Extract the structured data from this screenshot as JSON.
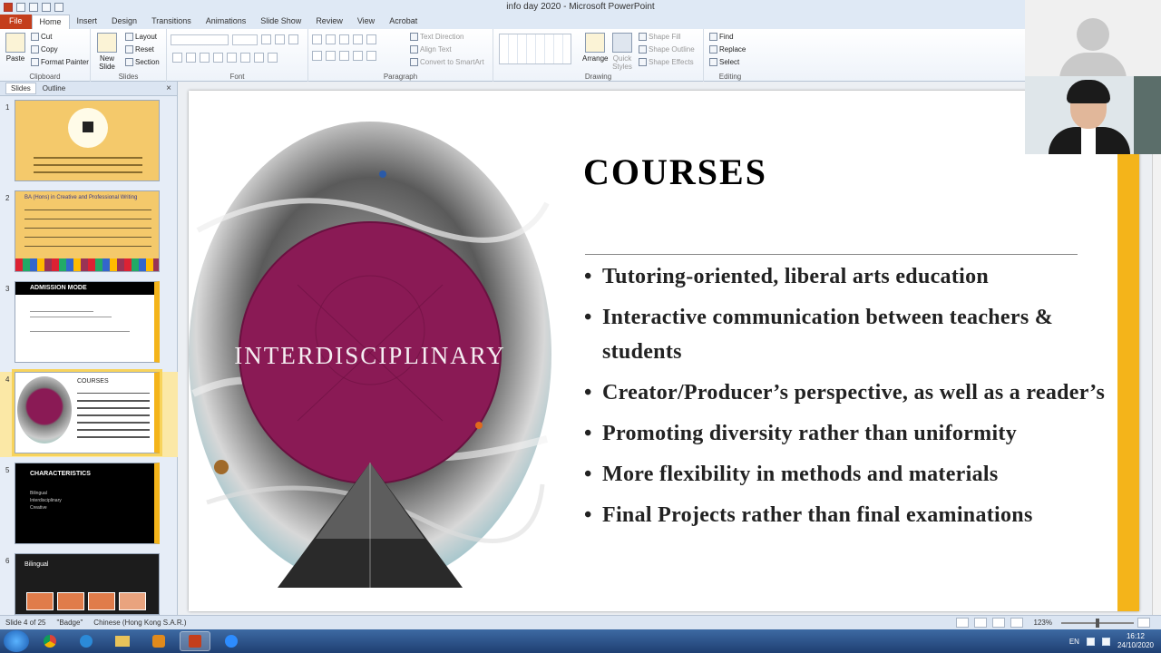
{
  "window": {
    "title": "info day 2020  -  Microsoft PowerPoint"
  },
  "tabs": [
    {
      "label": "File"
    },
    {
      "label": "Home"
    },
    {
      "label": "Insert"
    },
    {
      "label": "Design"
    },
    {
      "label": "Transitions"
    },
    {
      "label": "Animations"
    },
    {
      "label": "Slide Show"
    },
    {
      "label": "Review"
    },
    {
      "label": "View"
    },
    {
      "label": "Acrobat"
    }
  ],
  "ribbon": {
    "clipboard": {
      "paste": "Paste",
      "cut": "Cut",
      "copy": "Copy",
      "format_painter": "Format Painter",
      "label": "Clipboard"
    },
    "slides": {
      "new_slide": "New Slide",
      "layout": "Layout",
      "reset": "Reset",
      "section": "Section",
      "label": "Slides"
    },
    "font": {
      "label": "Font"
    },
    "paragraph": {
      "text_direction": "Text Direction",
      "align_text": "Align Text",
      "convert_smartart": "Convert to SmartArt",
      "label": "Paragraph"
    },
    "drawing": {
      "arrange": "Arrange",
      "quick_styles": "Quick Styles",
      "shape_fill": "Shape Fill",
      "shape_outline": "Shape Outline",
      "shape_effects": "Shape Effects",
      "label": "Drawing"
    },
    "editing": {
      "find": "Find",
      "replace": "Replace",
      "select": "Select",
      "label": "Editing"
    }
  },
  "panel": {
    "tab_slides": "Slides",
    "tab_outline": "Outline",
    "close": "×",
    "thumbnails": [
      {
        "num": "1"
      },
      {
        "num": "2",
        "heading": "BA (Hons) in Creative and Professional Writing"
      },
      {
        "num": "3",
        "heading": "ADMISSION MODE"
      },
      {
        "num": "4",
        "heading": "COURSES"
      },
      {
        "num": "5",
        "heading": "CHARACTERISTICS",
        "items": [
          "Bilingual",
          "Interdisciplinary",
          "Creative"
        ]
      },
      {
        "num": "6",
        "heading": "Bilingual"
      }
    ]
  },
  "slide": {
    "art_text": "INTERDISCIPLINARY",
    "title": "COURSES",
    "bullets": [
      "Tutoring-oriented, liberal arts education",
      "Interactive communication between teachers & students",
      "Creator/Producer’s perspective, as well as a reader’s",
      "Promoting diversity rather than uniformity",
      "More flexibility in methods and materials",
      "Final Projects rather than final examinations"
    ]
  },
  "status": {
    "slide_info": "Slide 4 of 25",
    "theme": "\"Badge\"",
    "language": "Chinese (Hong Kong S.A.R.)",
    "zoom": "123%"
  },
  "taskbar": {
    "lang": "EN",
    "time": "16:12",
    "date": "24/10/2020"
  }
}
